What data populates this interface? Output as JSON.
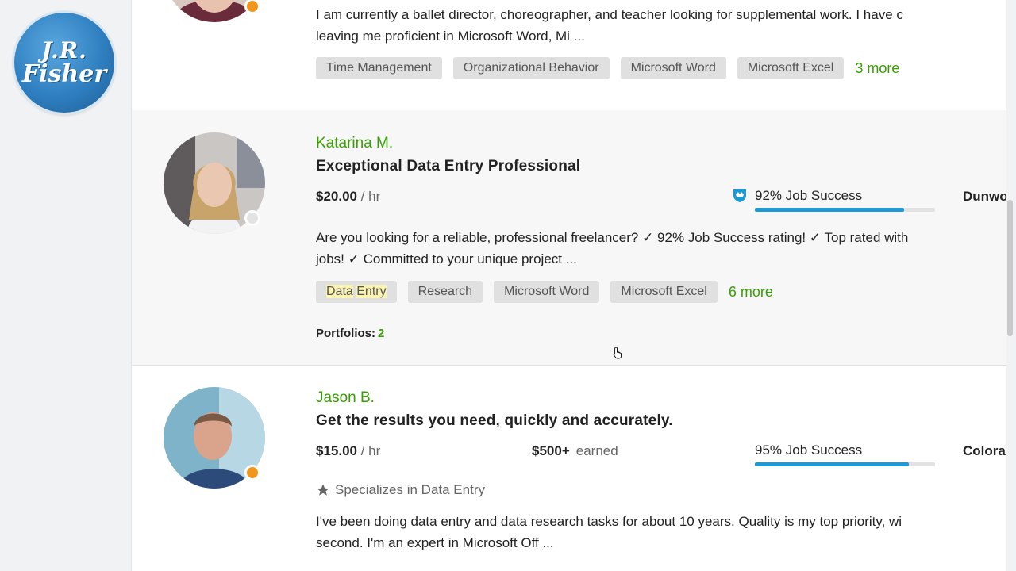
{
  "logo": {
    "line1": "J.R.",
    "line2": "Fisher"
  },
  "freelancers": [
    {
      "description": [
        "I am currently a ballet director, choreographer, and teacher looking for supplemental work. I have c",
        "leaving me proficient in Microsoft Word, Mi ..."
      ],
      "skills": [
        "Time Management",
        "Organizational Behavior",
        "Microsoft Word",
        "Microsoft Excel"
      ],
      "more": "3 more",
      "status": "orange"
    },
    {
      "name": "Katarina M.",
      "title": "Exceptional Data Entry Professional",
      "rate": "$20.00",
      "rate_unit": "/ hr",
      "job_success": "92% Job Success",
      "job_success_pct": 92,
      "location": "Dunwo",
      "description": [
        "Are you looking for a reliable, professional freelancer? ✓ 92% Job Success rating! ✓ Top rated with",
        "jobs! ✓ Committed to your unique project ..."
      ],
      "skills": [
        "Research",
        "Microsoft Word",
        "Microsoft Excel"
      ],
      "skill_highlight": {
        "word1": "Data",
        "word2": "Entry"
      },
      "more": "6 more",
      "portfolios_label": "Portfolios:",
      "portfolios_count": "2",
      "status": "grey",
      "badge_icon": "top-rated-shield-icon"
    },
    {
      "name": "Jason B.",
      "title": "Get the results you need, quickly and accurately.",
      "rate": "$15.00",
      "rate_unit": "/ hr",
      "earned": "$500+",
      "earned_label": "earned",
      "job_success": "95% Job Success",
      "job_success_pct": 95,
      "location": "Colora",
      "specializes": "Specializes in Data Entry",
      "description": [
        "I've been doing data entry and data research tasks for about 10 years. Quality is my top priority, wi",
        "second. I'm an expert in Microsoft Off ..."
      ],
      "status": "orange"
    }
  ],
  "colors": {
    "accent_green": "#37a000",
    "progress_blue": "#1d9ad6",
    "status_orange": "#f0961e"
  }
}
